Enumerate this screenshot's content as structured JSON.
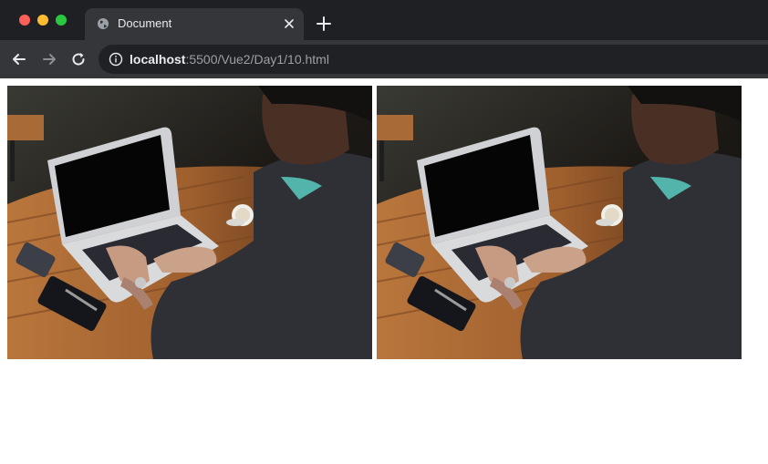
{
  "browser": {
    "window_controls": [
      "close",
      "minimize",
      "maximize"
    ],
    "tab": {
      "title": "Document",
      "icon": "globe-icon",
      "close_icon": "close-icon"
    },
    "new_tab_icon": "plus-icon",
    "nav": {
      "back_icon": "arrow-left-icon",
      "forward_icon": "arrow-right-icon",
      "reload_icon": "reload-icon"
    },
    "address_bar": {
      "info_icon": "info-icon",
      "host": "localhost",
      "rest": ":5500/Vue2/Day1/10.html"
    }
  },
  "page": {
    "images": [
      {
        "alt": ""
      },
      {
        "alt": ""
      }
    ]
  },
  "colors": {
    "chrome_dark": "#202124",
    "toolbar": "#35363a",
    "close": "#ff5f57",
    "minimize": "#febc2e",
    "maximize": "#28c840"
  }
}
